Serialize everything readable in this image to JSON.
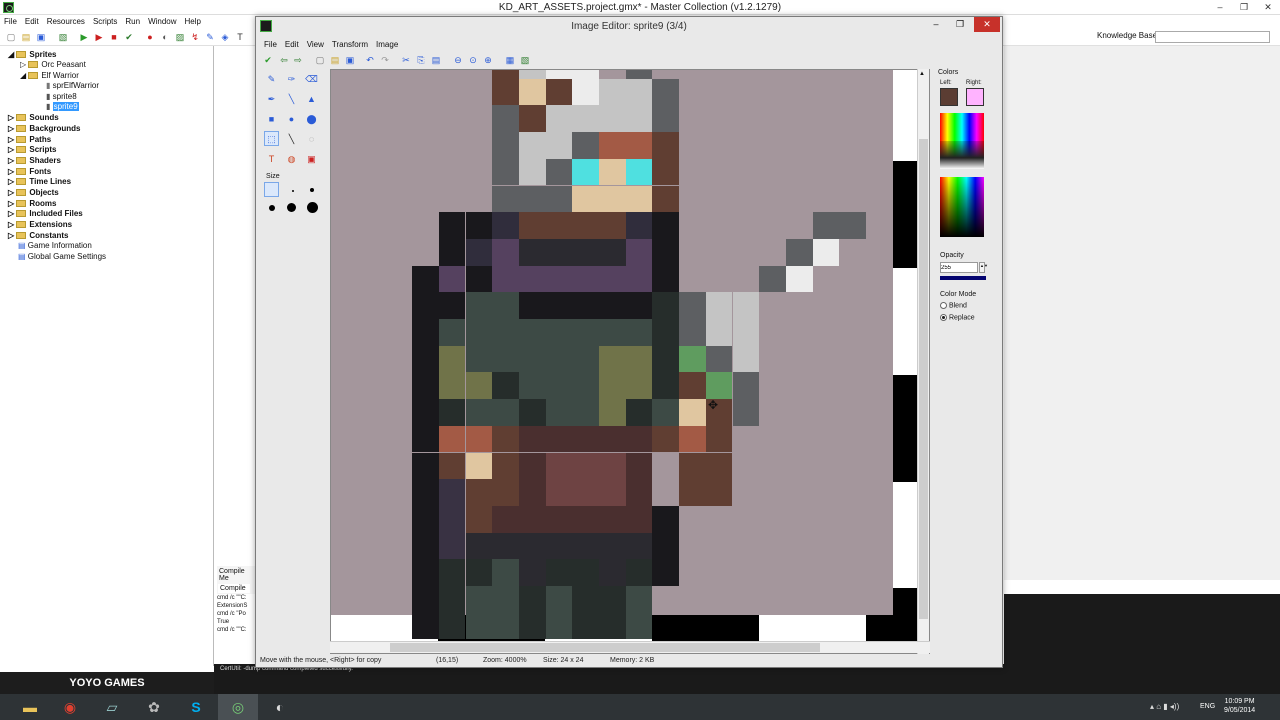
{
  "window": {
    "title": "KD_ART_ASSETS.project.gmx* - Master Collection (v1.2.1279)",
    "minimize": "–",
    "maximize": "❐",
    "close": "✕"
  },
  "menu": [
    "File",
    "Edit",
    "Resources",
    "Scripts",
    "Run",
    "Window",
    "Help"
  ],
  "knowledge_base": {
    "label": "Knowledge Base:",
    "value": ""
  },
  "tree": {
    "sprites": "Sprites",
    "orc": "Orc Peasant",
    "elf": "Elf Warrior",
    "spr_elf": "sprElfWarrior",
    "sprite8": "sprite8",
    "sprite9": "sprite9",
    "sounds": "Sounds",
    "backgrounds": "Backgrounds",
    "paths": "Paths",
    "scripts": "Scripts",
    "shaders": "Shaders",
    "fonts": "Fonts",
    "timelines": "Time Lines",
    "objects": "Objects",
    "rooms": "Rooms",
    "included": "Included Files",
    "extensions": "Extensions",
    "constants": "Constants",
    "gameinfo": "Game Information",
    "settings": "Global Game Settings"
  },
  "compile": {
    "tab_header": "Compile Me",
    "tab": "Compile",
    "lines": [
      "cmd /c \"\"C:",
      "",
      "ExtensionS",
      "cmd /c \"Po",
      "",
      "True",
      "cmd /c \"\"C:"
    ],
    "message": "CertUtil: -dump command completed successfully."
  },
  "brand": "YOYO GAMES",
  "editor": {
    "title": "Image Editor: sprite9 (3/4)",
    "menu": [
      "File",
      "Edit",
      "View",
      "Transform",
      "Image"
    ],
    "size_label": "Size",
    "status": {
      "hint": "Move with the mouse, <Right> for copy",
      "coords": "(16,15)",
      "zoom": "Zoom: 4000%",
      "size": "Size: 24 x 24",
      "memory": "Memory: 2 KB"
    },
    "colors": {
      "title": "Colors",
      "left_label": "Left:",
      "right_label": "Right:",
      "left": "#5b3d33",
      "right": "#ffb3ff",
      "opacity_label": "Opacity",
      "opacity": "255",
      "mode_label": "Color Mode",
      "blend": "Blend",
      "replace": "Replace"
    }
  },
  "taskbar": {
    "lang": "ENG",
    "time": "10:09 PM",
    "date": "9/05/2014"
  },
  "sprite": {
    "bg": "#a4969c",
    "palette": {
      "B": "#19181c",
      "D": "#2b2a30",
      "G": "#5d5f62",
      "L": "#c4c4c4",
      "W": "#ececec",
      "S": "#e0c6a0",
      "H": "#603e32",
      "R": "#a35a45",
      "C": "#4fe0e0",
      "N": "#302d3c",
      "P": "#55415f",
      "T": "#3d4a45",
      "E": "#262d2b",
      "O": "#707349",
      "M": "#4a2f2f",
      "K": "#6e4343",
      "Q": "#393243",
      "V": "#5f9c5f",
      "X": "#000000"
    },
    "rows": [
      "......HLWW.G....",
      "......HSHWLLG...",
      "......GHLLLLG...",
      "......GLLGRRH...",
      "......GLGCSCH...",
      "......GGGSSSH...",
      "....BBNHHHHNB.....GG",
      "....BNPDDDDPB....GW",
      "...BPBPPPPPPB...GW",
      "...BBTTBBBBBEGLL",
      "...BTTTTTTTTEGLL",
      "...BOTTTTTOOEVGL",
      "...BOOETTTOOEHVG",
      "...BETTETTOETSHG",
      "...BRRHMMMMMHRH",
      "...BHSHMKKKM.HH",
      "...BQHHMKKKM.HH",
      "...BQHMMMMMMB",
      "...BQDDDDDDDB",
      "...BEETDEEDEB",
      "...BETTETEET",
      "...BETTETEET"
    ]
  }
}
